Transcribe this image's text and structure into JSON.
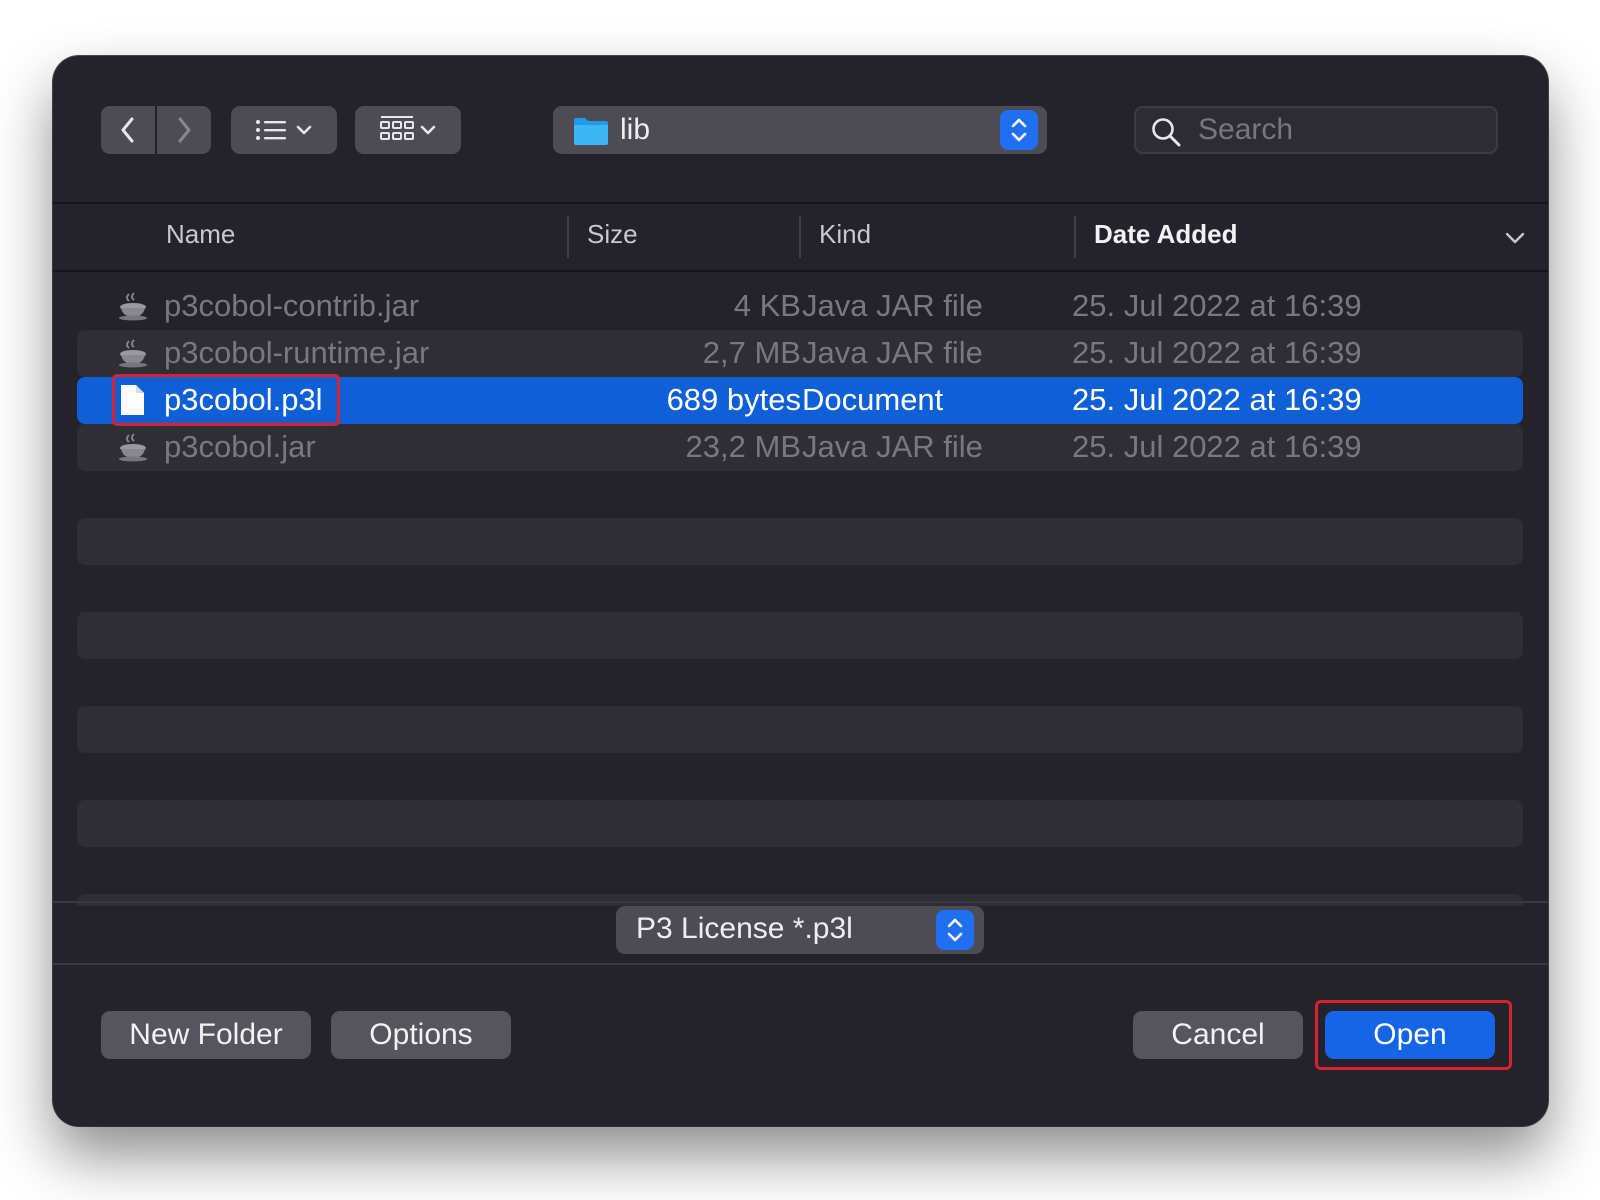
{
  "toolbar": {
    "back_icon": "chevron-left-icon",
    "forward_icon": "chevron-right-icon",
    "list_view_icon": "list-icon",
    "grid_view_icon": "grid-icon",
    "path": {
      "label": "lib",
      "icon": "folder-icon"
    },
    "search": {
      "placeholder": "Search",
      "value": ""
    }
  },
  "file_list": {
    "columns": [
      "Name",
      "Size",
      "Kind",
      "Date Added"
    ],
    "sorted_by": "Date Added",
    "rows": [
      {
        "name": "p3cobol-contrib.jar",
        "size": "4 KB",
        "kind": "Java JAR file",
        "date_added": "25. Jul 2022 at 16:39",
        "icon": "java-jar-icon",
        "state": "disabled"
      },
      {
        "name": "p3cobol-runtime.jar",
        "size": "2,7 MB",
        "kind": "Java JAR file",
        "date_added": "25. Jul 2022 at 16:39",
        "icon": "java-jar-icon",
        "state": "disabled"
      },
      {
        "name": "p3cobol.p3l",
        "size": "689 bytes",
        "kind": "Document",
        "date_added": "25. Jul 2022 at 16:39",
        "icon": "document-icon",
        "state": "selected"
      },
      {
        "name": "p3cobol.jar",
        "size": "23,2 MB",
        "kind": "Java JAR file",
        "date_added": "25. Jul 2022 at 16:39",
        "icon": "java-jar-icon",
        "state": "disabled"
      }
    ]
  },
  "file_format": {
    "label": "P3 License *.p3l"
  },
  "buttons": {
    "new_folder": "New Folder",
    "options": "Options",
    "cancel": "Cancel",
    "open": "Open"
  },
  "colors": {
    "window_background": "#24222b",
    "selection": "#0f5fd6",
    "primary_button": "#1565e6",
    "annotation_highlight": "#d8232f"
  }
}
